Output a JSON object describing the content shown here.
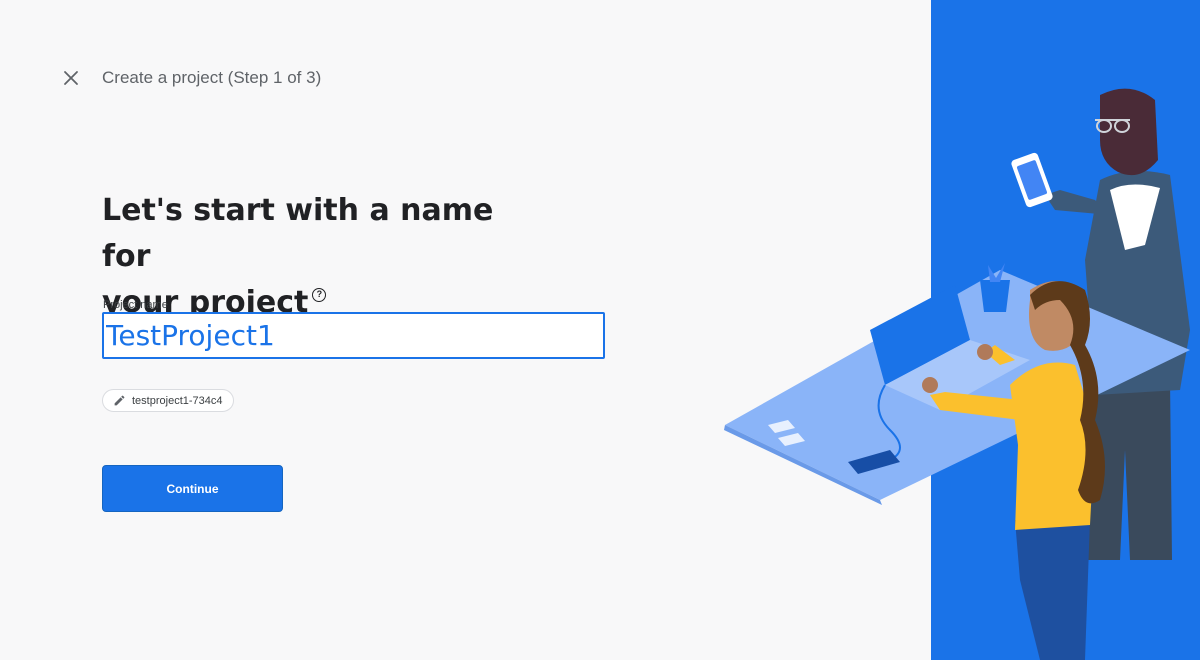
{
  "header": {
    "close_icon": "close-icon",
    "step_title": "Create a project (Step 1 of 3)"
  },
  "main": {
    "heading_line1": "Let's start with a name for",
    "heading_line2": "your project",
    "help_icon": "help-circle-icon",
    "help_glyph": "?",
    "project_name_label": "Project name",
    "project_name_value": "TestProject1",
    "project_id_icon": "pencil-icon",
    "project_id": "testproject1-734c4",
    "continue_label": "Continue"
  },
  "illustration": {
    "name": "people-at-desk-illustration",
    "accent_color": "#1a73e8"
  },
  "colors": {
    "background": "#f8f8f9",
    "accent": "#1a73e8",
    "panel_blue": "#1a73e8"
  }
}
